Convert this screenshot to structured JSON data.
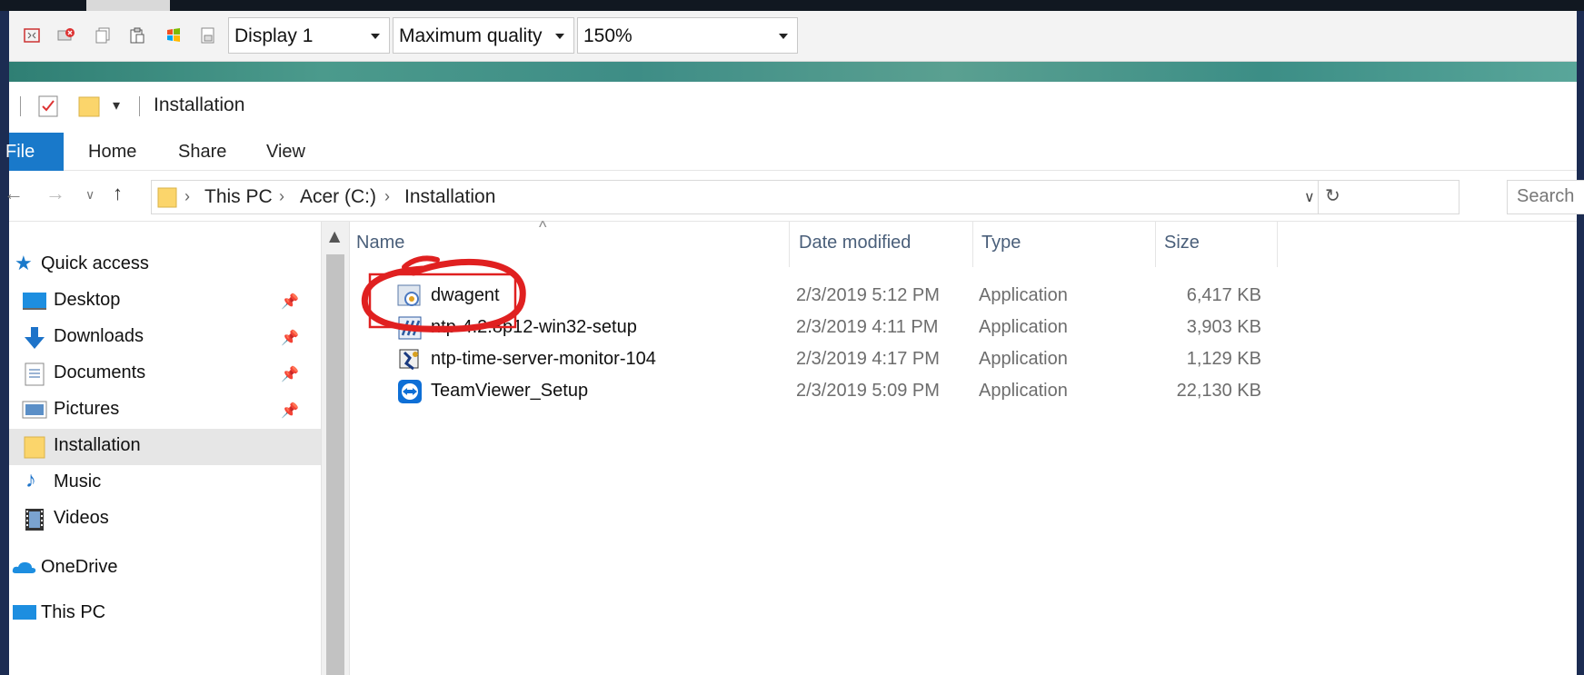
{
  "remote_toolbar": {
    "display_select": "Display 1",
    "quality_select": "Maximum quality",
    "zoom_select": "150%",
    "icons": [
      "fullscreen-icon",
      "disconnect-icon",
      "copy-icon",
      "paste-icon",
      "windows-key-icon",
      "ctrl-alt-del-icon"
    ]
  },
  "explorer": {
    "title": "Installation",
    "ribbon_tabs": [
      "File",
      "Home",
      "Share",
      "View"
    ],
    "breadcrumb": [
      "This PC",
      "Acer (C:)",
      "Installation"
    ],
    "search_placeholder": "Search",
    "nav": {
      "quick_access": "Quick access",
      "items": [
        {
          "label": "Desktop",
          "icon": "desktop-icon",
          "pinned": true
        },
        {
          "label": "Downloads",
          "icon": "downloads-icon",
          "pinned": true
        },
        {
          "label": "Documents",
          "icon": "documents-icon",
          "pinned": true
        },
        {
          "label": "Pictures",
          "icon": "pictures-icon",
          "pinned": true
        },
        {
          "label": "Installation",
          "icon": "folder-icon",
          "pinned": false,
          "selected": true
        },
        {
          "label": "Music",
          "icon": "music-icon",
          "pinned": false
        },
        {
          "label": "Videos",
          "icon": "videos-icon",
          "pinned": false
        }
      ],
      "onedrive": "OneDrive",
      "this_pc": "This PC"
    },
    "columns": [
      "Name",
      "Date modified",
      "Type",
      "Size"
    ],
    "files": [
      {
        "name": "dwagent",
        "date": "2/3/2019 5:12 PM",
        "type": "Application",
        "size": "6,417 KB",
        "icon": "dwagent-app-icon",
        "highlighted": true
      },
      {
        "name": "ntp-4.2.8p12-win32-setup",
        "date": "2/3/2019 4:11 PM",
        "type": "Application",
        "size": "3,903 KB",
        "icon": "installer-app-icon"
      },
      {
        "name": "ntp-time-server-monitor-104",
        "date": "2/3/2019 4:17 PM",
        "type": "Application",
        "size": "1,129 KB",
        "icon": "monitor-app-icon"
      },
      {
        "name": "TeamViewer_Setup",
        "date": "2/3/2019 5:09 PM",
        "type": "Application",
        "size": "22,130 KB",
        "icon": "teamviewer-app-icon"
      }
    ]
  },
  "colors": {
    "ribbon_file_tab": "#1979ca",
    "annotation_red": "#e02020",
    "selected_nav_bg": "#e6e6e6"
  }
}
